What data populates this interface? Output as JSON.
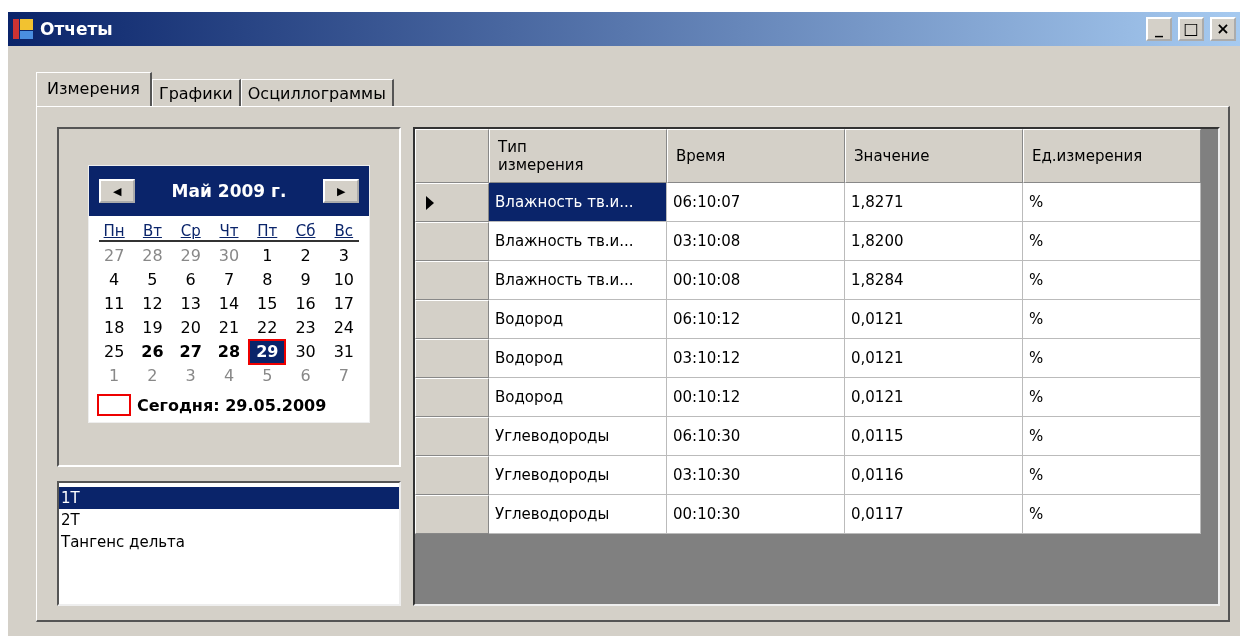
{
  "window": {
    "title": "Отчеты",
    "buttons": [
      "_",
      "□",
      "×"
    ]
  },
  "tabs": [
    {
      "label": "Измерения",
      "selected": true
    },
    {
      "label": "Графики",
      "selected": false
    },
    {
      "label": "Осциллограммы",
      "selected": false
    }
  ],
  "calendar": {
    "prev": "◀",
    "next": "▶",
    "month": "Май 2009 г.",
    "weekdays": [
      "Пн",
      "Вт",
      "Ср",
      "Чт",
      "Пт",
      "Сб",
      "Вс"
    ],
    "weeks": [
      [
        {
          "text": "27",
          "muted": true,
          "bold": false,
          "selected": false
        },
        {
          "text": "28",
          "muted": true,
          "bold": false,
          "selected": false
        },
        {
          "text": "29",
          "muted": true,
          "bold": false,
          "selected": false
        },
        {
          "text": "30",
          "muted": true,
          "bold": false,
          "selected": false
        },
        {
          "text": "1",
          "muted": false,
          "bold": false,
          "selected": false
        },
        {
          "text": "2",
          "muted": false,
          "bold": false,
          "selected": false
        },
        {
          "text": "3",
          "muted": false,
          "bold": false,
          "selected": false
        }
      ],
      [
        {
          "text": "4",
          "muted": false,
          "bold": false,
          "selected": false
        },
        {
          "text": "5",
          "muted": false,
          "bold": false,
          "selected": false
        },
        {
          "text": "6",
          "muted": false,
          "bold": false,
          "selected": false
        },
        {
          "text": "7",
          "muted": false,
          "bold": false,
          "selected": false
        },
        {
          "text": "8",
          "muted": false,
          "bold": false,
          "selected": false
        },
        {
          "text": "9",
          "muted": false,
          "bold": false,
          "selected": false
        },
        {
          "text": "10",
          "muted": false,
          "bold": false,
          "selected": false
        }
      ],
      [
        {
          "text": "11",
          "muted": false,
          "bold": false,
          "selected": false
        },
        {
          "text": "12",
          "muted": false,
          "bold": false,
          "selected": false
        },
        {
          "text": "13",
          "muted": false,
          "bold": false,
          "selected": false
        },
        {
          "text": "14",
          "muted": false,
          "bold": false,
          "selected": false
        },
        {
          "text": "15",
          "muted": false,
          "bold": false,
          "selected": false
        },
        {
          "text": "16",
          "muted": false,
          "bold": false,
          "selected": false
        },
        {
          "text": "17",
          "muted": false,
          "bold": false,
          "selected": false
        }
      ],
      [
        {
          "text": "18",
          "muted": false,
          "bold": false,
          "selected": false
        },
        {
          "text": "19",
          "muted": false,
          "bold": false,
          "selected": false
        },
        {
          "text": "20",
          "muted": false,
          "bold": false,
          "selected": false
        },
        {
          "text": "21",
          "muted": false,
          "bold": false,
          "selected": false
        },
        {
          "text": "22",
          "muted": false,
          "bold": false,
          "selected": false
        },
        {
          "text": "23",
          "muted": false,
          "bold": false,
          "selected": false
        },
        {
          "text": "24",
          "muted": false,
          "bold": false,
          "selected": false
        }
      ],
      [
        {
          "text": "25",
          "muted": false,
          "bold": false,
          "selected": false
        },
        {
          "text": "26",
          "muted": false,
          "bold": true,
          "selected": false
        },
        {
          "text": "27",
          "muted": false,
          "bold": true,
          "selected": false
        },
        {
          "text": "28",
          "muted": false,
          "bold": true,
          "selected": false
        },
        {
          "text": "29",
          "muted": false,
          "bold": true,
          "selected": true
        },
        {
          "text": "30",
          "muted": false,
          "bold": false,
          "selected": false
        },
        {
          "text": "31",
          "muted": false,
          "bold": false,
          "selected": false
        }
      ],
      [
        {
          "text": "1",
          "muted": true,
          "bold": false,
          "selected": false
        },
        {
          "text": "2",
          "muted": true,
          "bold": false,
          "selected": false
        },
        {
          "text": "3",
          "muted": true,
          "bold": false,
          "selected": false
        },
        {
          "text": "4",
          "muted": true,
          "bold": false,
          "selected": false
        },
        {
          "text": "5",
          "muted": true,
          "bold": false,
          "selected": false
        },
        {
          "text": "6",
          "muted": true,
          "bold": false,
          "selected": false
        },
        {
          "text": "7",
          "muted": true,
          "bold": false,
          "selected": false
        }
      ]
    ],
    "today": "Сегодня: 29.05.2009"
  },
  "list": [
    {
      "label": "1T",
      "selected": true
    },
    {
      "label": "2T",
      "selected": false
    },
    {
      "label": "Тангенс дельта",
      "selected": false
    }
  ],
  "table": {
    "columns": [
      "Тип\nизмерения",
      "Время",
      "Значение",
      "Ед.измерения"
    ],
    "rows": [
      {
        "current": true,
        "cells": [
          "Влажность тв.и...",
          "06:10:07",
          "1,8271",
          "%"
        ]
      },
      {
        "current": false,
        "cells": [
          "Влажность тв.и...",
          "03:10:08",
          "1,8200",
          "%"
        ]
      },
      {
        "current": false,
        "cells": [
          "Влажность тв.и...",
          "00:10:08",
          "1,8284",
          "%"
        ]
      },
      {
        "current": false,
        "cells": [
          "Водород",
          "06:10:12",
          "0,0121",
          "%"
        ]
      },
      {
        "current": false,
        "cells": [
          "Водород",
          "03:10:12",
          "0,0121",
          "%"
        ]
      },
      {
        "current": false,
        "cells": [
          "Водород",
          "00:10:12",
          "0,0121",
          "%"
        ]
      },
      {
        "current": false,
        "cells": [
          "Углеводороды",
          "06:10:30",
          "0,0115",
          "%"
        ]
      },
      {
        "current": false,
        "cells": [
          "Углеводороды",
          "03:10:30",
          "0,0116",
          "%"
        ]
      },
      {
        "current": false,
        "cells": [
          "Углеводороды",
          "00:10:30",
          "0,0117",
          "%"
        ]
      }
    ]
  }
}
